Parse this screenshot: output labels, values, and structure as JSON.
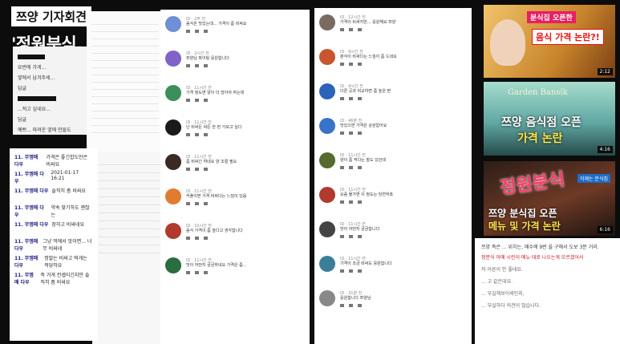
{
  "headline": {
    "top": "쯔양 기자회견",
    "main": "'정원분식, 가격논란'"
  },
  "left_panel": {
    "rows": [
      "요번에 가게...",
      "옆에서 남겨주세...",
      "답글",
      "",
      "...적고 싶네요...",
      "답글",
      "",
      "예쁘... 마려운 옆에 만들도"
    ]
  },
  "date_panel": {
    "rows": [
      {
        "user": "11. 무엠매 다우",
        "text": "가격은 좋긴합도만은 비싸요"
      },
      {
        "user": "11. 무엠매 다우",
        "text": "2021-01-17 16:21"
      },
      {
        "user": "11. 무엠매 다우",
        "text": "솔직히 좀 비싸요"
      },
      {
        "user": "11. 무엠매 다우",
        "text": "약속 맞기하도 괜찮는"
      },
      {
        "user": "11. 무엠매 다우",
        "text": "장하고 비싸네요"
      },
      {
        "user": "11. 무엠매 다우",
        "text": "그냥 먹에서 맛이면... 너무 비싸네"
      },
      {
        "user": "11. 무엠매 다우",
        "text": "정말는 비싸고 떡개는 적당하요"
      },
      {
        "user": "11. 무엠매 다우",
        "text": "즉 거게 컨셉이긴지만 솔직히 좀 비싸요"
      }
    ]
  },
  "comments_col1": [
    {
      "name": "ID · 2주 전",
      "text": "음식은 맛있는데... 가격이 좀 비싸요",
      "color": "#6f8fd6"
    },
    {
      "name": "ID · 2시간 전",
      "text": "쯔양님 파이팅 응원합니다",
      "color": "#7f63c7"
    },
    {
      "name": "ID · 11시간 전",
      "text": "가격 정도면 양이 더 많아야 하는데",
      "color": "#3a8f5b"
    },
    {
      "name": "ID · 11시간 전",
      "text": "난 비싸든 싸든 한 번 가보고 싶다",
      "color": "#1a1a1a"
    },
    {
      "name": "ID · 11시간 전",
      "text": "좀 비싸긴 하네요 양 조절 필요",
      "color": "#3a2a25"
    },
    {
      "name": "ID · 11시간 전",
      "text": "커플이면 가격 비싸다는 느낌이 있음",
      "color": "#e07c30"
    },
    {
      "name": "ID · 10시간 전",
      "text": "음식 가격이 좀 높다고 생각합니다",
      "color": "#b13a2d"
    },
    {
      "name": "ID · 11시간 전",
      "text": "맛이 어떤지 궁금하네요 가격은 좀...",
      "color": "#2a6d3f"
    }
  ],
  "comments_col2": [
    {
      "name": "ID · 12시간 전",
      "text": "가격이 비싸지만... 응원해요 쯔양",
      "color": "#7a6b60"
    },
    {
      "name": "ID · 9시간 전",
      "text": "분식이 비싸다는 느낌이 좀 드네요",
      "color": "#c8552d"
    },
    {
      "name": "ID · 9시간 전",
      "text": "다른 곳과 비교하면 좀 높은 편",
      "color": "#2c63b8"
    },
    {
      "name": "ID · 46분 전",
      "text": "맛있으면 가격은 상관없어요",
      "color": "#3a74c8"
    },
    {
      "name": "ID · 11시간 전",
      "text": "양이 좀 적다는 말도 있던데",
      "color": "#556b2f"
    },
    {
      "name": "ID · 11시간 전",
      "text": "요즘 물가면 이 정도는 당연하죠",
      "color": "#b03a2e"
    },
    {
      "name": "ID · 11시간 전",
      "text": "맛이 어떤지 궁금합니다",
      "color": "#444444"
    },
    {
      "name": "ID · 11시간 전",
      "text": "가격이 조금 비싸도 응원합니다",
      "color": "#3a7f9a"
    },
    {
      "name": "ID · 31분 전",
      "text": "응원합니다 쯔양님",
      "color": "#888888"
    }
  ],
  "thumbnails": [
    {
      "cap_a": "분식집 오픈한",
      "cap_b": "음식 가격 논란?!",
      "duration": "2:12"
    },
    {
      "sign": "Garden Banslk",
      "cap_a": "쯔양 음식점 오픈",
      "cap_b": "가격 논란",
      "duration": "4:16"
    },
    {
      "cap_a": "정원분식",
      "cap_b": "쯔양 분식집 오픈",
      "cap_c": "메뉴 및 가격 논란",
      "tag": "이제는 분식집",
      "duration": "6:16"
    }
  ],
  "right_info": {
    "line1": "쯔양 측은 ... 위치는, 매수에 9번 을 구해서 도보 3분 거리.",
    "line2": "정분식 아메 시린이 메뉴·대로 나오는게 모르겠어서",
    "line3": "저 어른이 안 좋네요.",
    "line4": "... 고 같은데요.",
    "line5": "... 부실해보이세인지,",
    "line6": "... 부실하다 의견이 많습니다."
  }
}
